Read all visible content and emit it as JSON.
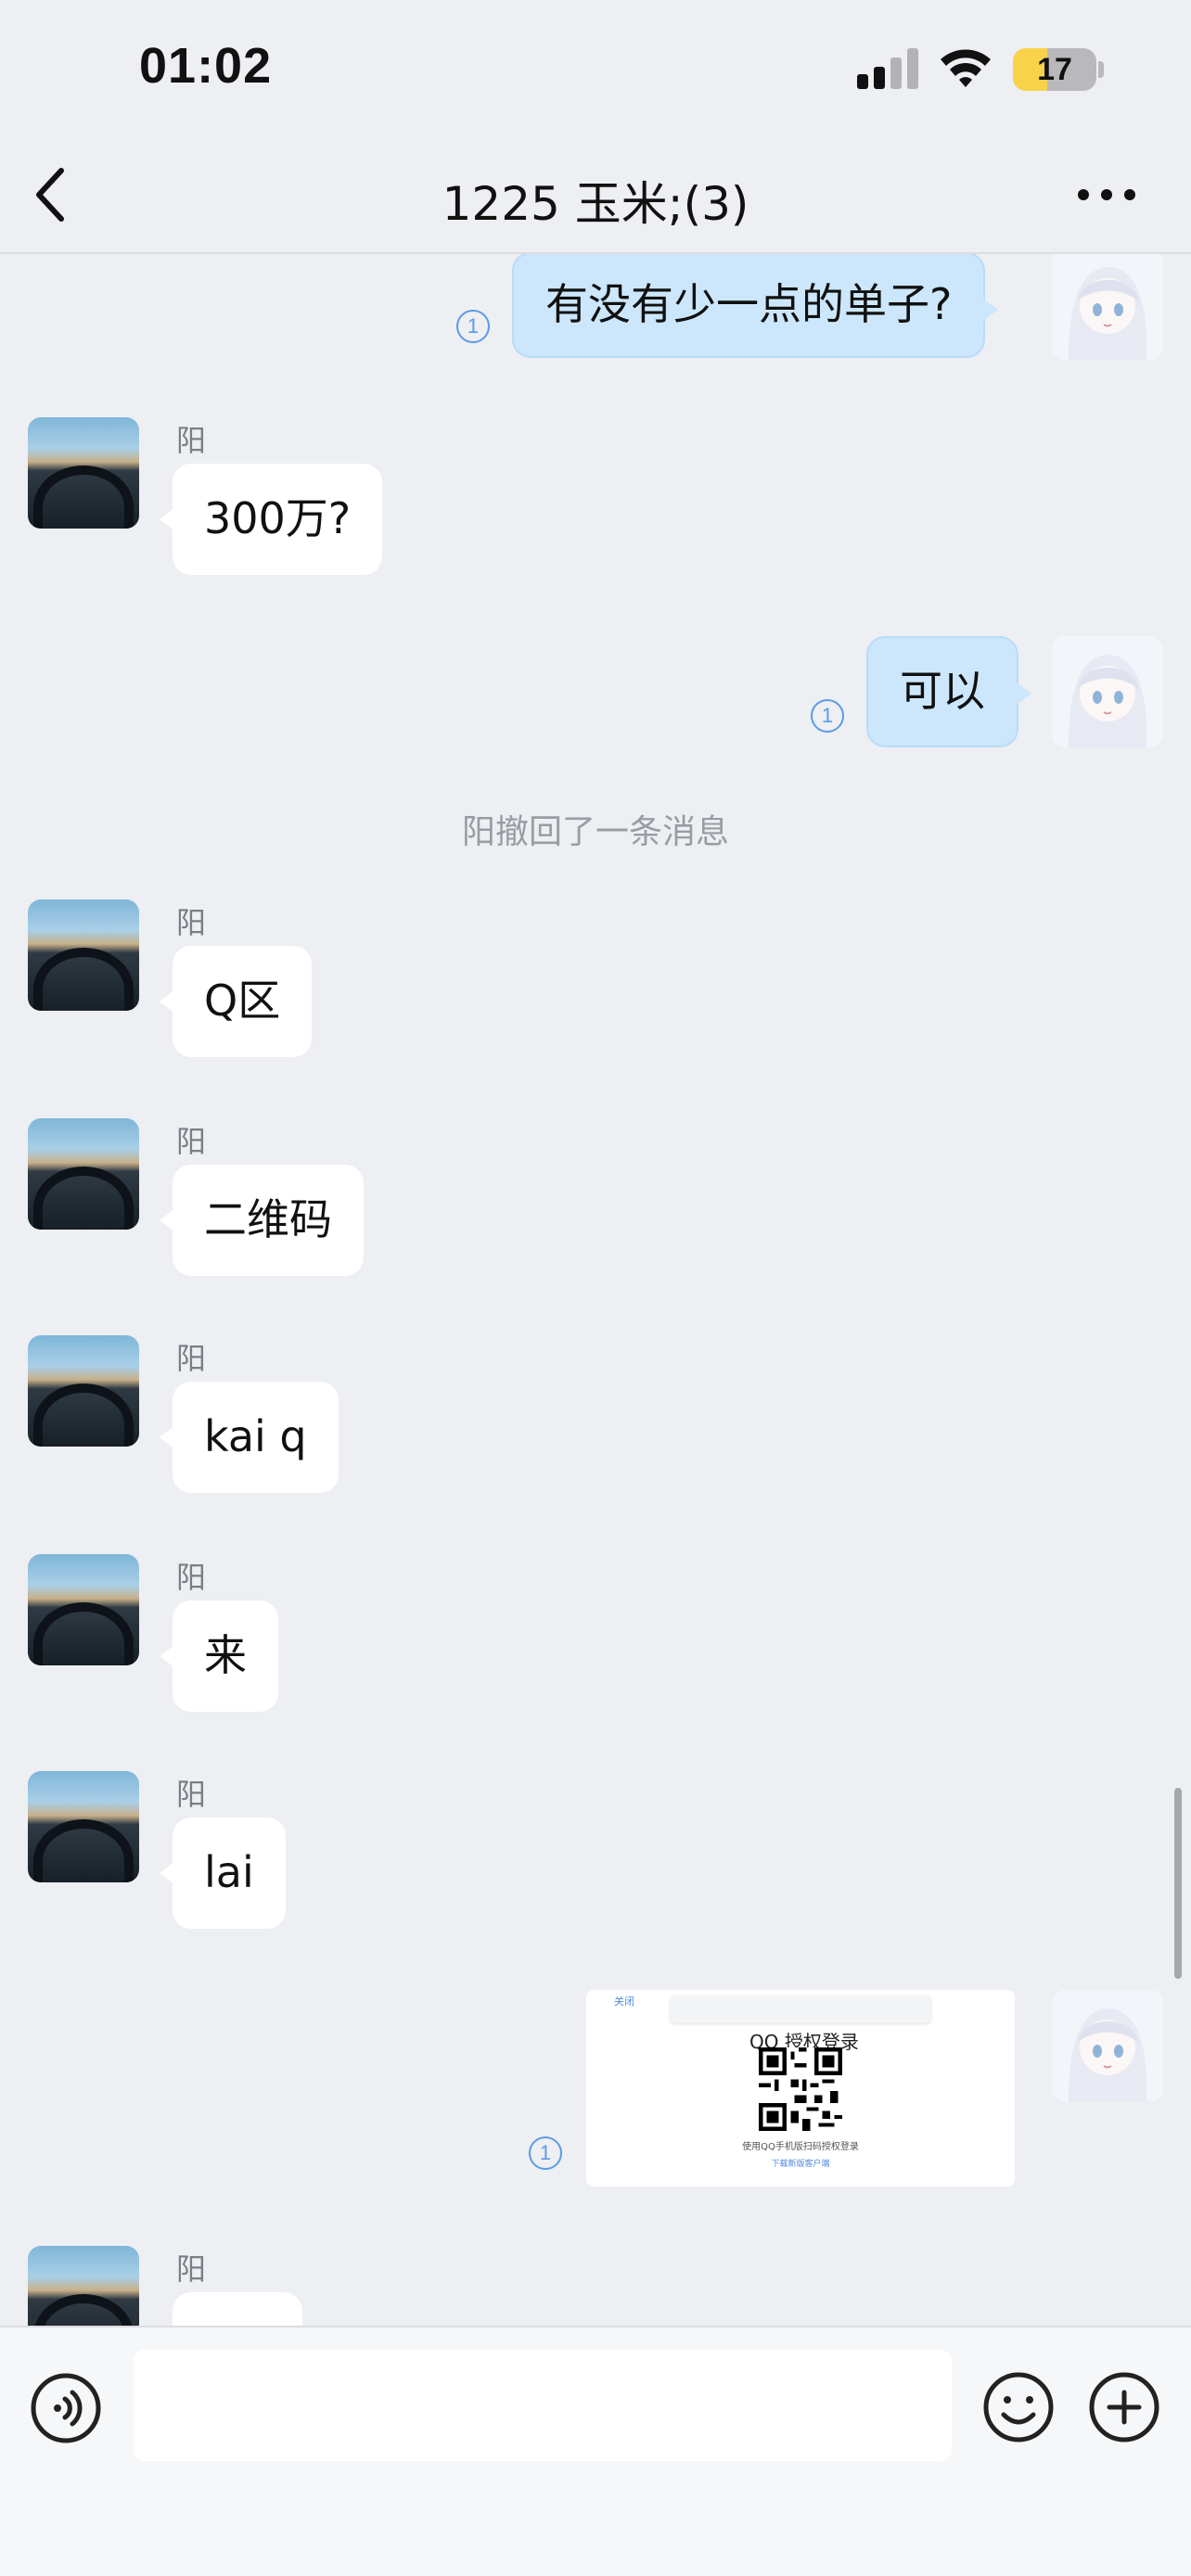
{
  "status_bar": {
    "time": "01:02",
    "battery": "17",
    "battery_level": 0.17
  },
  "header": {
    "title": "1225 玉米;(3)"
  },
  "messages": [
    {
      "type": "outgoing",
      "text": "有没有少一点的单子?",
      "read_count": "1"
    },
    {
      "type": "incoming",
      "sender": "阳",
      "text": "300万?"
    },
    {
      "type": "outgoing",
      "text": "可以",
      "read_count": "1"
    },
    {
      "type": "system",
      "text": "阳撤回了一条消息"
    },
    {
      "type": "incoming",
      "sender": "阳",
      "text": "Q区"
    },
    {
      "type": "incoming",
      "sender": "阳",
      "text": "二维码"
    },
    {
      "type": "incoming",
      "sender": "阳",
      "text": "kai q"
    },
    {
      "type": "incoming",
      "sender": "阳",
      "text": "来"
    },
    {
      "type": "incoming",
      "sender": "阳",
      "text": "lai"
    },
    {
      "type": "outgoing-image",
      "read_count": "1",
      "image": {
        "back": "关闭",
        "title": "QQ 授权登录",
        "caption": "使用QQ手机版扫码授权登录",
        "link": "下载新版客户端"
      }
    },
    {
      "type": "incoming",
      "sender": "阳",
      "text": ""
    }
  ],
  "input": {
    "placeholder": ""
  },
  "colors": {
    "bubble_out": "#cce7fc",
    "bubble_in": "#ffffff",
    "background": "#edeff3",
    "accent": "#5a9be6"
  }
}
